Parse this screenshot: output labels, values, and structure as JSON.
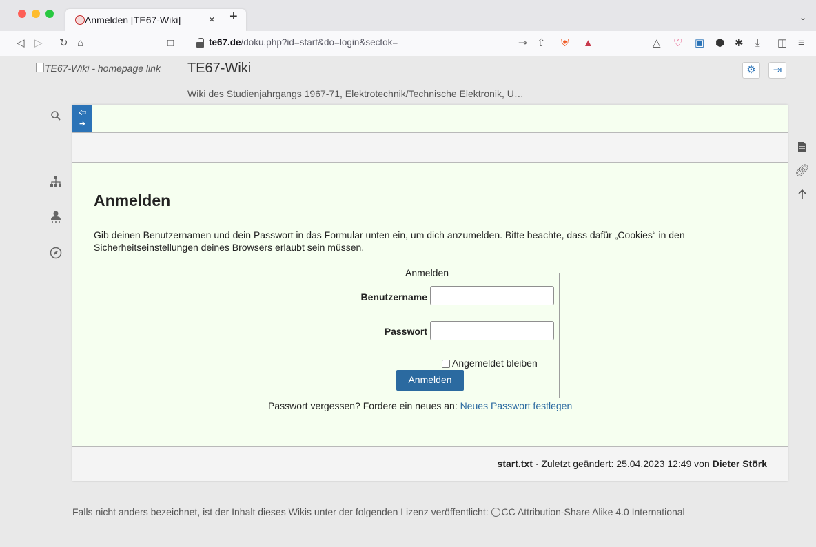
{
  "browser": {
    "tab_title": "Anmelden [TE67-Wiki]",
    "tab_close": "×",
    "new_tab": "+",
    "url_host": "te67.de",
    "url_path": "/doku.php?id=start&do=login&sectok="
  },
  "site": {
    "logo_alt": "TE67-Wiki - homepage link",
    "title": "TE67-Wiki",
    "tagline": "Wiki des Studienjahrgangs 1967-71, Elektrotechnik/Technische Elektronik, U…"
  },
  "main": {
    "heading": "Anmelden",
    "description": "Gib deinen Benutzernamen und dein Passwort in das Formular unten ein, um dich anzumelden. Bitte beachte, dass dafür „Cookies“ in den Sicherheitseinstellungen deines Browsers erlaubt sein müssen."
  },
  "login_form": {
    "legend": "Anmelden",
    "username_label": "Benutzername",
    "username_value": "",
    "password_label": "Passwort",
    "password_value": "",
    "remember_label": "Angemeldet bleiben",
    "remember_checked": false,
    "submit_label": "Anmelden"
  },
  "forgot": {
    "text": "Passwort vergessen? Fordere ein neues an: ",
    "link_label": "Neues Passwort festlegen"
  },
  "docinfo": {
    "filename": "start.txt",
    "changed_text": " · Zuletzt geändert: 25.04.2023 12:49 von ",
    "author": "Dieter Störk"
  },
  "license": {
    "text": "Falls nicht anders bezeichnet, ist der Inhalt dieses Wikis unter der folgenden Lizenz veröffentlicht: ",
    "license_name": "CC Attribution-Share Alike 4.0 International"
  },
  "colors": {
    "accent": "#2b73b7",
    "content_bg": "#f6fff0",
    "link": "#2b6aa0"
  }
}
